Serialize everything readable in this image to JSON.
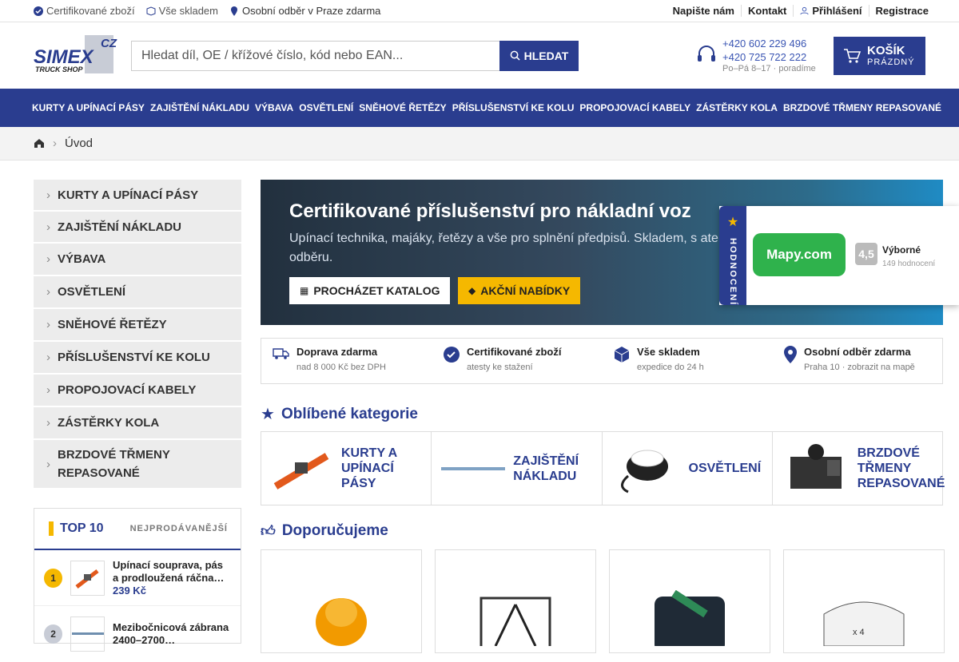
{
  "topbar": {
    "usp1": "Certifikované zboží",
    "usp2": "Vše skladem",
    "usp3": "Osobní odběr v Praze zdarma",
    "links": [
      "Napište nám",
      "Kontakt",
      "Přihlášení",
      "Registrace"
    ]
  },
  "logo": {
    "text": "SIMEX",
    "cz": "CZ",
    "sub": "TRUCK SHOP"
  },
  "search": {
    "placeholder": "Hledat díl, OE / křížové číslo, kód nebo EAN...",
    "button": "HLEDAT"
  },
  "contact": {
    "phone1": "+420 602 229 496",
    "phone2": "+420 725 722 222",
    "hours": "Po–Pá 8–17 · poradíme"
  },
  "cart": {
    "label": "KOŠÍK",
    "status": "PRÁZDNÝ"
  },
  "nav": [
    "KURTY A UPÍNACÍ PÁSY",
    "ZAJIŠTĚNÍ NÁKLADU",
    "VÝBAVA",
    "OSVĚTLENÍ",
    "SNĚHOVÉ ŘETĚZY",
    "PŘÍSLUŠENSTVÍ KE KOLU",
    "PROPOJOVACÍ KABELY",
    "ZÁSTĚRKY KOLA",
    "BRZDOVÉ TŘMENY REPASOVANÉ"
  ],
  "breadcrumb": "Úvod",
  "sidebar": [
    "KURTY A UPÍNACÍ PÁSY",
    "ZAJIŠTĚNÍ NÁKLADU",
    "VÝBAVA",
    "OSVĚTLENÍ",
    "SNĚHOVÉ ŘETĚZY",
    "PŘÍSLUŠENSTVÍ KE KOLU",
    "PROPOJOVACÍ KABELY",
    "ZÁSTĚRKY KOLA",
    "BRZDOVÉ TŘMENY REPASOVANÉ"
  ],
  "top10": {
    "title": "TOP 10",
    "subtitle": "NEJPRODÁVANĚJŠÍ",
    "items": [
      {
        "rank": "1",
        "name": "Upínací souprava, pás a prodloužená ráčna…",
        "price": "239 Kč"
      },
      {
        "rank": "2",
        "name": "Mezibočnicová zábrana 2400–2700…",
        "price": ""
      }
    ]
  },
  "hero": {
    "title": "Certifikované příslušenství pro nákladní voz",
    "text": "Upínací technika, majáky, řetězy a vše pro splnění předpisů. Skladem, s ate odběru.",
    "btn1": "PROCHÁZET KATALOG",
    "btn2": "AKČNÍ NABÍDKY"
  },
  "rating": {
    "tab": "HODNOCENÍ",
    "brand": "Mapy.com",
    "score": "4,5",
    "label": "Výborné",
    "count": "149 hodnocení"
  },
  "usps": [
    {
      "t": "Doprava zdarma",
      "s": "nad 8 000 Kč bez DPH"
    },
    {
      "t": "Certifikované zboží",
      "s": "atesty ke stažení"
    },
    {
      "t": "Vše skladem",
      "s": "expedice do 24 h"
    },
    {
      "t": "Osobní odběr zdarma",
      "s": "Praha 10 · zobrazit na mapě"
    }
  ],
  "sections": {
    "fav": "Oblíbené kategorie",
    "rec": "Doporučujeme"
  },
  "fav_cats": [
    "KURTY A UPÍNACÍ PÁSY",
    "ZAJIŠTĚNÍ NÁKLADU",
    "OSVĚTLENÍ",
    "BRZDOVÉ TŘMENY REPASOVANÉ"
  ],
  "colors": {
    "primary": "#2a3d8f",
    "accent": "#f5b800"
  }
}
